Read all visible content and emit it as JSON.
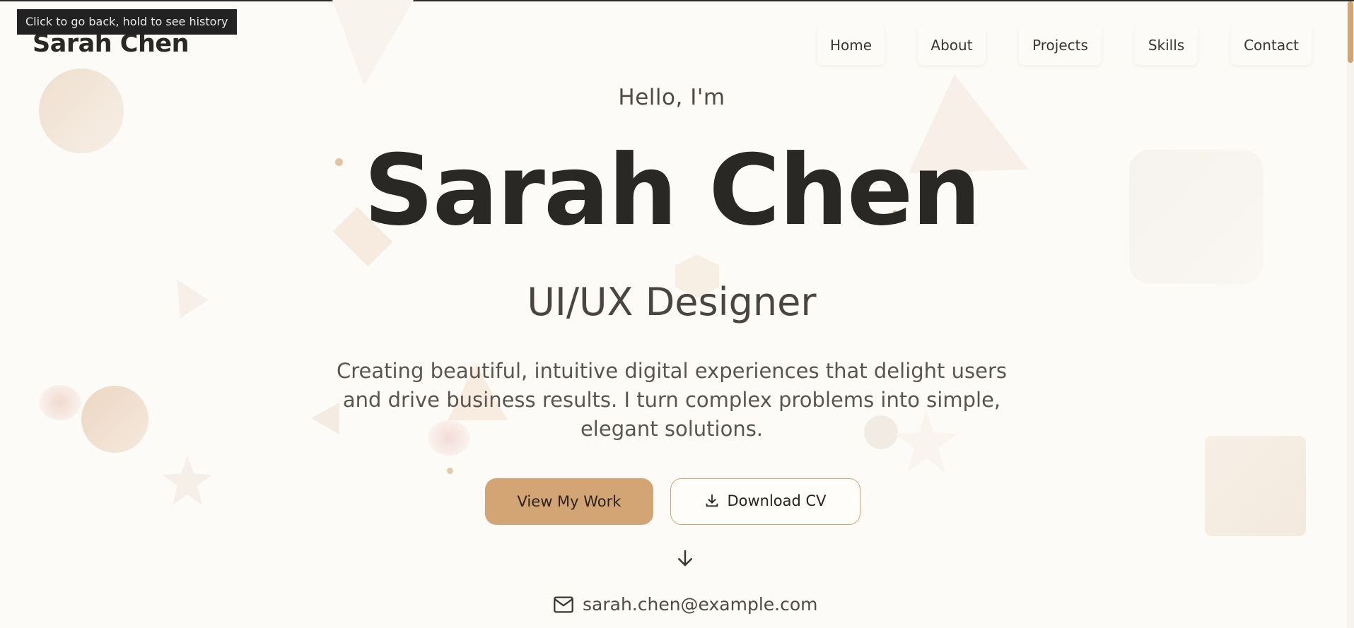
{
  "tooltip": "Click to go back, hold to see history",
  "brand": "Sarah Chen",
  "nav": {
    "home": "Home",
    "about": "About",
    "projects": "Projects",
    "skills": "Skills",
    "contact": "Contact"
  },
  "hero": {
    "greeting": "Hello, I'm",
    "name": "Sarah Chen",
    "role": "UI/UX Designer",
    "description": "Creating beautiful, intuitive digital experiences that delight users and drive business results. I turn complex problems into simple, elegant solutions.",
    "primary_button": "View My Work",
    "secondary_button": "Download CV",
    "email": "sarah.chen@example.com"
  },
  "icons": {
    "download": "download-icon",
    "scroll": "arrow-down-icon",
    "mail": "mail-icon"
  },
  "colors": {
    "accent": "#d4a574",
    "background": "#fdfbf7",
    "text": "#2a2824"
  }
}
